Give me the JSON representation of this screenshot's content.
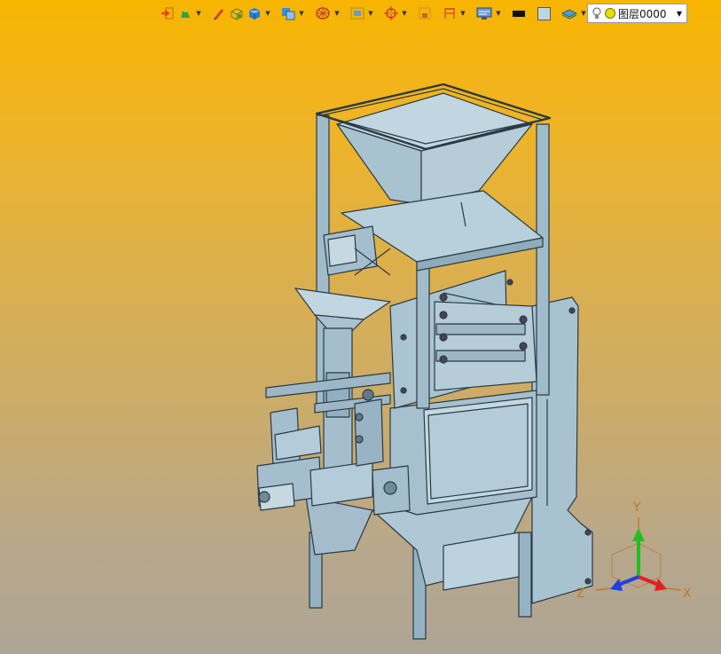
{
  "toolbar": {
    "buttons": [
      {
        "icon": "exit-sketch-icon",
        "color": "#e04020"
      },
      {
        "icon": "extrude-dropdown-icon",
        "color": "#3aa040"
      },
      {
        "icon": "pencil-icon",
        "color": "#d04030"
      },
      {
        "icon": "box-solid-icon",
        "color": "#e0c020"
      },
      {
        "icon": "cube-dropdown-icon",
        "color": "#2a7ad0"
      },
      {
        "icon": "cube-shaded-dropdown-icon",
        "color": "#3a90d8"
      },
      {
        "icon": "wheel-dropdown-icon",
        "color": "#c04030"
      },
      {
        "icon": "view-frame-dropdown-icon",
        "color": "#d0a020"
      },
      {
        "icon": "target-dropdown-icon",
        "color": "#d04020"
      },
      {
        "icon": "panel-icon",
        "color": "#d0a020"
      },
      {
        "icon": "dimension-dropdown-icon",
        "color": "#d06020"
      },
      {
        "icon": "display-dropdown-icon",
        "color": "#2a7ad0"
      }
    ],
    "color_swatch_black": "#111111",
    "color_swatch_light": "#bcd6e6",
    "layers_icon_color": "#4aa0c8"
  },
  "layer": {
    "name": "图层0000"
  },
  "triad": {
    "x_label": "X",
    "y_label": "Y",
    "z_label": "Z",
    "x_color": "#e02020",
    "y_color": "#20c020",
    "z_color": "#2040e0"
  },
  "colors": {
    "model_fill": "#9cb8c8",
    "model_stroke": "#2a3a44",
    "bg_top": "#f7b500",
    "bg_bottom": "#aea595"
  }
}
